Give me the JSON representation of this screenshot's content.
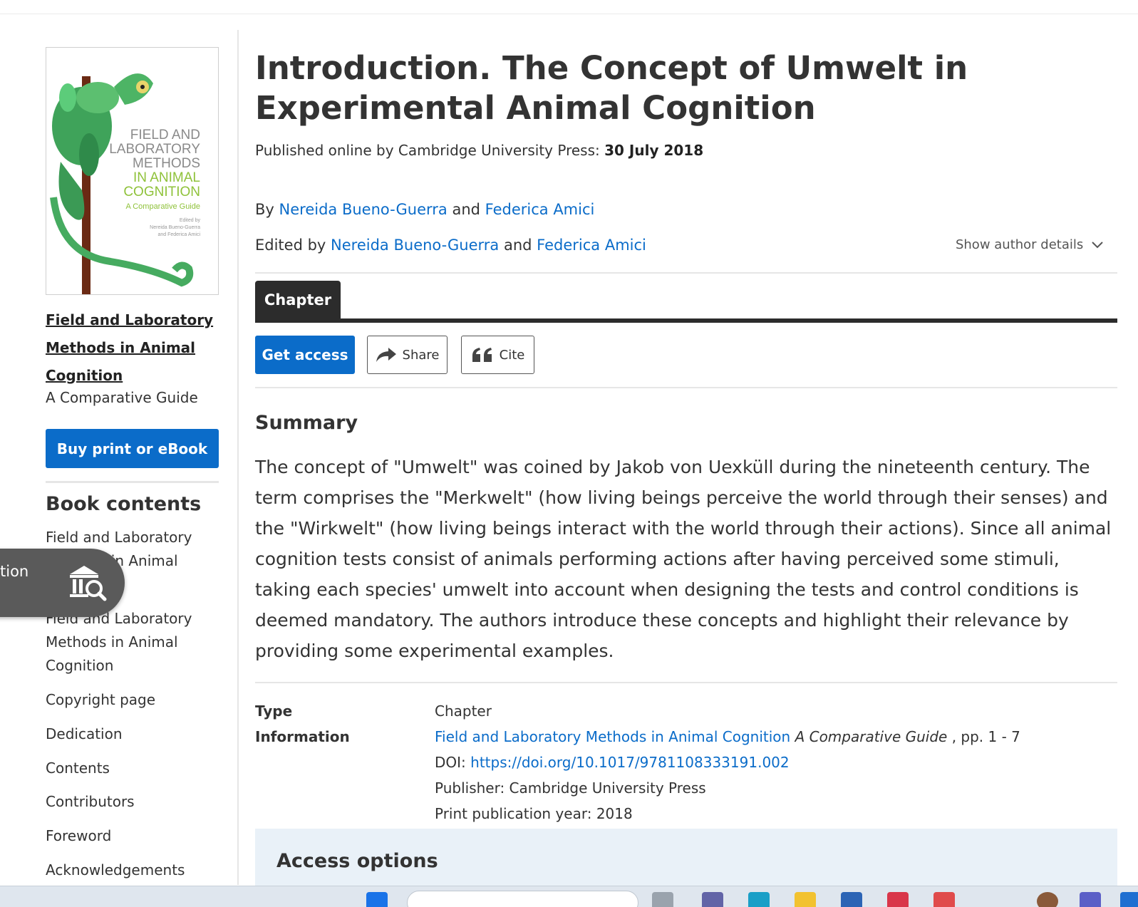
{
  "sidebar": {
    "cover": {
      "title_lines": [
        "FIELD AND",
        "LABORATORY",
        "METHODS",
        "IN ANIMAL",
        "COGNITION"
      ],
      "subtitle": "A Comparative Guide",
      "edited_line1": "Edited by",
      "edited_line2": "Nereida Bueno-Guerra",
      "edited_line3": "and Federica Amici"
    },
    "book_title": "Field and Laboratory Methods in Animal Cognition",
    "book_subtitle": "A Comparative Guide",
    "buy_label": "Buy print or eBook",
    "contents_heading": "Book contents",
    "toc": [
      {
        "label": "Field and Laboratory Methods in Animal Cognition"
      },
      {
        "label": "Field and Laboratory Methods in Animal Cognition"
      },
      {
        "label": "Copyright page"
      },
      {
        "label": "Dedication"
      },
      {
        "label": "Contents"
      },
      {
        "label": "Contributors"
      },
      {
        "label": "Foreword"
      },
      {
        "label": "Acknowledgements"
      }
    ],
    "institution_pill": "tion"
  },
  "main": {
    "title": "Introduction. The Concept of Umwelt in Experimental Animal Cognition",
    "published_prefix": "Published online by Cambridge University Press:",
    "published_date": "30 July 2018",
    "by_prefix": "By",
    "author1": "Nereida Bueno-Guerra",
    "and1": "and",
    "author2": "Federica Amici",
    "edited_prefix": "Edited by",
    "editor1": "Nereida Bueno-Guerra",
    "and2": "and",
    "editor2": "Federica Amici",
    "show_author_details": "Show author details",
    "tab_chapter": "Chapter",
    "get_access": "Get access",
    "share": "Share",
    "cite": "Cite",
    "summary_heading": "Summary",
    "summary_text": "The concept of \"Umwelt\" was coined by Jakob von Uexküll during the nineteenth century. The term comprises the \"Merkwelt\" (how living beings perceive the world through their senses) and the \"Wirkwelt\" (how living beings interact with the world through their actions). Since all animal cognition tests consist of animals performing actions after having perceived some stimuli, taking each species' umwelt into account when designing the tests and control conditions is deemed mandatory. The authors introduce these concepts and highlight their relevance by providing some experimental examples.",
    "type_label": "Type",
    "type_value": "Chapter",
    "info_label": "Information",
    "info_book_link": "Field and Laboratory Methods in Animal Cognition",
    "info_book_subtitle": "A Comparative Guide",
    "info_pages": ", pp. 1 - 7",
    "doi_prefix": "DOI:",
    "doi_link": "https://doi.org/10.1017/9781108333191.002",
    "publisher": "Publisher: Cambridge University Press",
    "print_year": "Print publication year: 2018",
    "access_options": "Access options"
  },
  "colors": {
    "brand_blue": "#0b6cc9",
    "dark_tab": "#2c2c2c",
    "access_bg": "#e9f1f8"
  }
}
